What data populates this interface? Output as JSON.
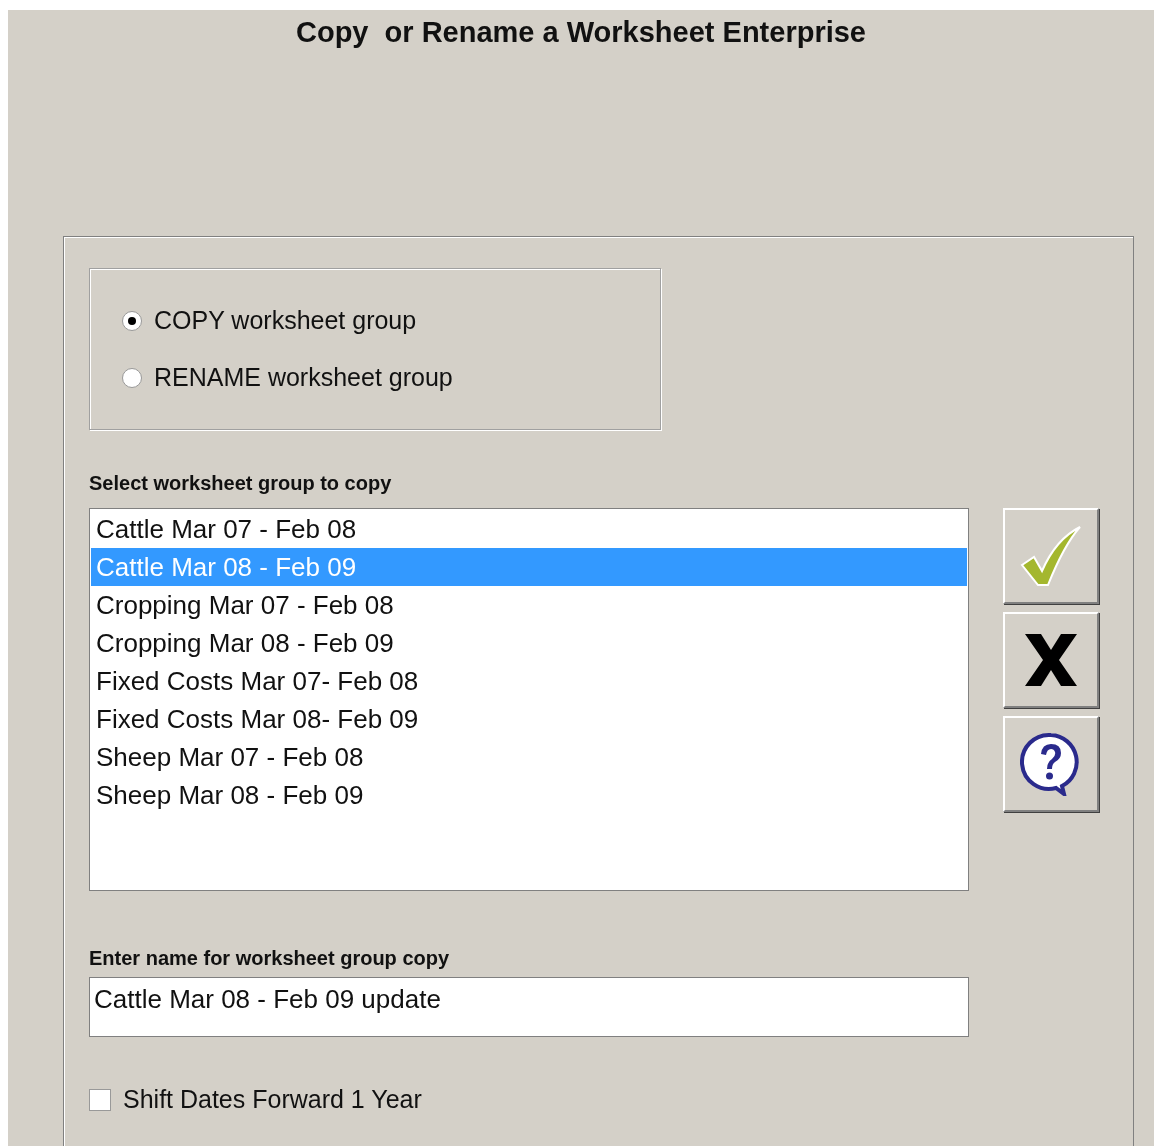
{
  "window": {
    "title": "Copy  or Rename a Worksheet Enterprise"
  },
  "mode_options": [
    {
      "label": "COPY worksheet group",
      "selected": true
    },
    {
      "label": "RENAME worksheet group",
      "selected": false
    }
  ],
  "group_list": {
    "label": "Select worksheet group to copy",
    "items": [
      {
        "text": "Cattle Mar 07 - Feb 08",
        "selected": false
      },
      {
        "text": "Cattle Mar 08 - Feb 09",
        "selected": true
      },
      {
        "text": "Cropping Mar 07 - Feb 08",
        "selected": false
      },
      {
        "text": "Cropping Mar 08 - Feb 09",
        "selected": false
      },
      {
        "text": "Fixed Costs Mar 07- Feb 08",
        "selected": false
      },
      {
        "text": "Fixed Costs Mar 08- Feb 09",
        "selected": false
      },
      {
        "text": "Sheep Mar 07 - Feb 08",
        "selected": false
      },
      {
        "text": "Sheep Mar 08 - Feb 09",
        "selected": false
      }
    ]
  },
  "buttons": [
    {
      "kind": "ok"
    },
    {
      "kind": "cancel"
    },
    {
      "kind": "help"
    }
  ],
  "name_field": {
    "label": "Enter name for worksheet group copy",
    "value": "Cattle Mar 08 - Feb 09 update"
  },
  "shift_dates": {
    "label": "Shift Dates Forward 1 Year",
    "checked": false
  }
}
